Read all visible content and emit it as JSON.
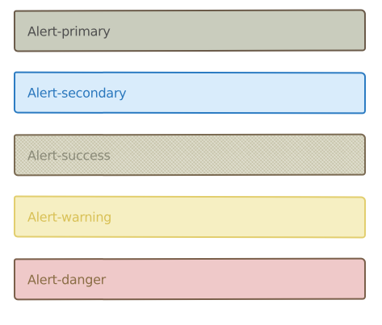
{
  "alerts": {
    "primary": {
      "label": "Alert-primary"
    },
    "secondary": {
      "label": "Alert-secondary"
    },
    "success": {
      "label": "Alert-success"
    },
    "warning": {
      "label": "Alert-warning"
    },
    "danger": {
      "label": "Alert-danger"
    }
  },
  "colors": {
    "primary_bg": "#c9ccbd",
    "secondary_bg": "#d9ecfb",
    "secondary_border": "#2b7bc2",
    "success_bg": "#d4d2bd",
    "warning_bg": "#f6efc2",
    "warning_border": "#e2ce6e",
    "danger_bg": "#efc9c9"
  }
}
